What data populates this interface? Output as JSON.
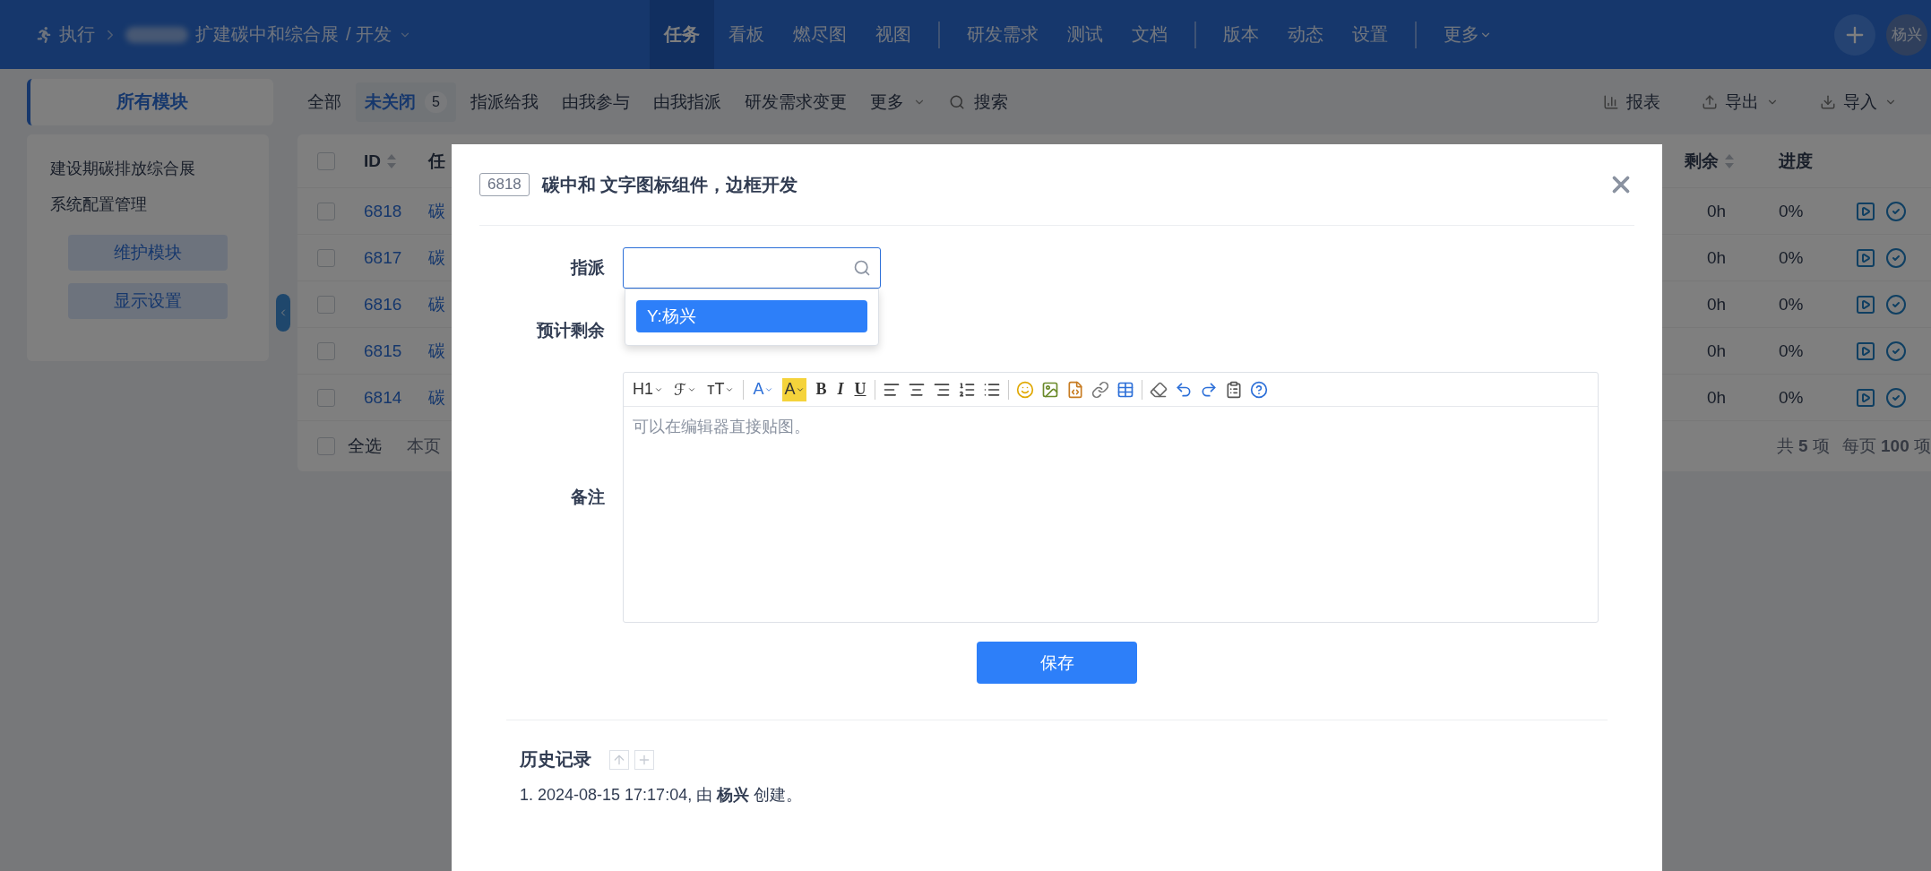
{
  "topbar": {
    "app": "执行",
    "breadcrumb": "扩建碳中和综合展",
    "branch": "/ 开发",
    "nav_groups": [
      {
        "items": [
          {
            "label": "任务",
            "selected": true
          },
          {
            "label": "看板",
            "selected": false
          },
          {
            "label": "燃尽图",
            "selected": false
          },
          {
            "label": "视图",
            "selected": false
          }
        ]
      },
      {
        "items": [
          {
            "label": "研发需求",
            "selected": false
          },
          {
            "label": "测试",
            "selected": false
          },
          {
            "label": "文档",
            "selected": false
          }
        ]
      },
      {
        "items": [
          {
            "label": "版本",
            "selected": false
          },
          {
            "label": "动态",
            "selected": false
          },
          {
            "label": "设置",
            "selected": false
          }
        ]
      }
    ],
    "more": "更多",
    "avatar": "杨兴"
  },
  "subnav": {
    "module_tab": "所有模块",
    "tabs": [
      {
        "label": "全部",
        "selected": false
      },
      {
        "label": "未关闭",
        "selected": true,
        "count": "5"
      },
      {
        "label": "指派给我",
        "selected": false
      },
      {
        "label": "由我参与",
        "selected": false
      },
      {
        "label": "由我指派",
        "selected": false
      },
      {
        "label": "研发需求变更",
        "selected": false
      }
    ],
    "more": "更多",
    "search": "搜索",
    "actions": [
      {
        "kind": "report",
        "label": "报表"
      },
      {
        "kind": "export",
        "label": "导出"
      },
      {
        "kind": "import",
        "label": "导入"
      }
    ]
  },
  "sidebar": {
    "items": [
      "建设期碳排放综合展",
      "系统配置管理"
    ],
    "buttons": [
      "维护模块",
      "显示设置"
    ]
  },
  "table": {
    "columns": [
      {
        "kind": "id",
        "label": "ID",
        "sortable": true
      },
      {
        "kind": "title",
        "label": "任"
      },
      {
        "kind": "remaining",
        "label": "剩余",
        "sortable": true
      },
      {
        "kind": "progress",
        "label": "进度",
        "sortable": false
      }
    ],
    "rows": [
      {
        "checked": false,
        "cells": [
          "6818",
          "碳",
          "0h",
          "0%"
        ]
      },
      {
        "checked": false,
        "cells": [
          "6817",
          "碳",
          "0h",
          "0%"
        ]
      },
      {
        "checked": false,
        "cells": [
          "6816",
          "碳",
          "0h",
          "0%"
        ]
      },
      {
        "checked": false,
        "cells": [
          "6815",
          "碳",
          "0h",
          "0%"
        ]
      },
      {
        "checked": false,
        "cells": [
          "6814",
          "碳",
          "0h",
          "0%"
        ]
      }
    ],
    "select_all": {
      "label": "全选",
      "checked": false
    },
    "page_info": "本页",
    "total": "共 **5** 项",
    "per_page": "每页 **100** 项"
  },
  "modal": {
    "id": "6818",
    "title": "碳中和 文字图标组件，边框开发",
    "assign_label": "指派",
    "assign_options": [
      {
        "label": "Y:杨兴",
        "selected": true
      }
    ],
    "remaining_label": "预计剩余",
    "note_label": "备注",
    "toolbar": [
      {
        "kind": "heading",
        "label": "H1"
      },
      {
        "kind": "font",
        "label": "ℱ"
      },
      {
        "kind": "size",
        "label": "ᴛT"
      },
      {
        "kind": "separator"
      },
      {
        "kind": "color",
        "label": "A"
      },
      {
        "kind": "highlight",
        "label": "A"
      },
      {
        "kind": "bold",
        "label": "B"
      },
      {
        "kind": "italic",
        "label": "I"
      },
      {
        "kind": "underline",
        "label": "U"
      },
      {
        "kind": "separator"
      },
      {
        "kind": "align-left"
      },
      {
        "kind": "align-center"
      },
      {
        "kind": "align-right"
      },
      {
        "kind": "ordered-list"
      },
      {
        "kind": "bullet-list"
      },
      {
        "kind": "separator"
      },
      {
        "kind": "emoji"
      },
      {
        "kind": "image"
      },
      {
        "kind": "code"
      },
      {
        "kind": "link"
      },
      {
        "kind": "table"
      },
      {
        "kind": "separator"
      },
      {
        "kind": "eraser"
      },
      {
        "kind": "undo"
      },
      {
        "kind": "redo"
      },
      {
        "kind": "paste"
      },
      {
        "kind": "help"
      }
    ],
    "note_placeholder": "可以在编辑器直接贴图。",
    "save": "保存",
    "history": {
      "title": "历史记录",
      "entries": [
        "1. 2024-08-15 17:17:04, 由 **杨兴** 创建。"
      ]
    }
  }
}
